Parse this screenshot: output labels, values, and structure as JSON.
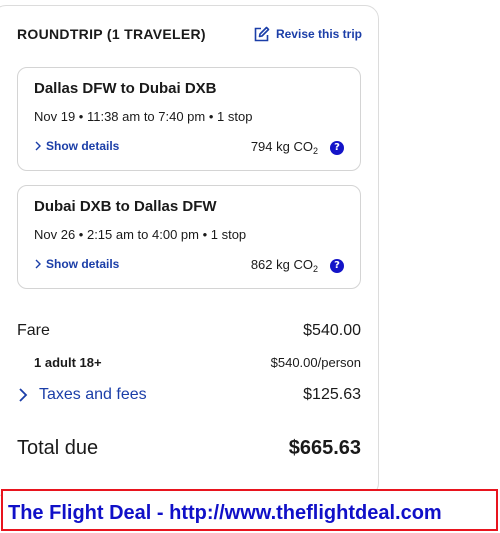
{
  "header": {
    "title": "ROUNDTRIP (1 TRAVELER)",
    "revise_label": "Revise this trip"
  },
  "flights": [
    {
      "route": "Dallas DFW to Dubai DXB",
      "times": "Nov 19 • 11:38 am to 7:40 pm • 1 stop",
      "details_label": "Show details",
      "co2_value": "794 kg CO",
      "co2_sub": "2"
    },
    {
      "route": "Dubai DXB to Dallas DFW",
      "times": "Nov 26 • 2:15 am to 4:00 pm • 1 stop",
      "details_label": "Show details",
      "co2_value": "862 kg CO",
      "co2_sub": "2"
    }
  ],
  "pricing": {
    "fare_label": "Fare",
    "fare_amount": "$540.00",
    "adult_label": "1 adult 18+",
    "adult_amount": "$540.00/person",
    "taxes_label": "Taxes and fees",
    "taxes_amount": "$125.63",
    "total_label": "Total due",
    "total_amount": "$665.63"
  },
  "banner": {
    "text": "The Flight Deal - http://www.theflightdeal.com"
  },
  "colors": {
    "link": "#1b3ea8",
    "help_icon": "#1414c8",
    "banner_border": "#e8141e",
    "banner_text": "#1010c8"
  },
  "icons": {
    "help": "?"
  }
}
